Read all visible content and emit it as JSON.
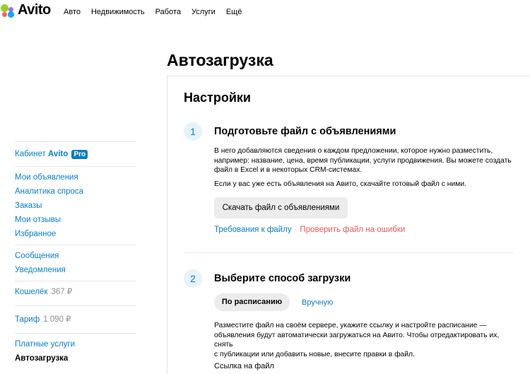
{
  "header": {
    "logo_text": "Avito",
    "nav": [
      "Авто",
      "Недвижимость",
      "Работа",
      "Услуги",
      "Ещё"
    ]
  },
  "page": {
    "title": "Автозагрузка"
  },
  "sidebar": {
    "cabinet_label": "Кабинет",
    "cabinet_brand": "Avito",
    "cabinet_badge": "Pro",
    "group1": [
      "Мои объявления",
      "Аналитика спроса",
      "Заказы",
      "Мои отзывы",
      "Избранное"
    ],
    "group2": [
      "Сообщения",
      "Уведомления"
    ],
    "wallet_label": "Кошелёк",
    "wallet_value": "367 ₽",
    "tariff_label": "Тариф",
    "tariff_value": "1 090 ₽",
    "group3": [
      "Платные услуги",
      "Автозагрузка"
    ]
  },
  "settings": {
    "title": "Настройки",
    "step1": {
      "number": "1",
      "title": "Подготовьте файл с объявлениями",
      "line1": "В него добавляются сведения о каждом предложении, которое нужно разместить,",
      "line2": "например: название, цена, время публикации, услуги продвижения. Вы можете создать",
      "line3": "файл в Excel и в некоторых CRM-системах.",
      "line4": "Если у вас уже есть объявления на Авито, скачайте готовый файл с ними.",
      "download_button": "Скачать файл с объявлениями",
      "link_requirements": "Требования к файлу",
      "link_separator": "·",
      "link_check": "Проверить файл на ошибки"
    },
    "step2": {
      "number": "2",
      "title": "Выберите способ загрузки",
      "tab_schedule": "По расписанию",
      "tab_manual": "Вручную",
      "line1": "Разместите файл на своём сервере, укажите ссылку и настройте расписание —",
      "line2": "объявления будут автоматически загружаться на Авито. Чтобы отредактировать их, снять",
      "line3": "с публикации или добавить новые, внесите правки в файл.",
      "file_link_label": "Ссылка на файл"
    }
  },
  "colors": {
    "link": "#0a7ec2",
    "error_link": "#e05a5a",
    "button_bg": "#ececec",
    "step_circle_bg": "#e7f3fb"
  }
}
